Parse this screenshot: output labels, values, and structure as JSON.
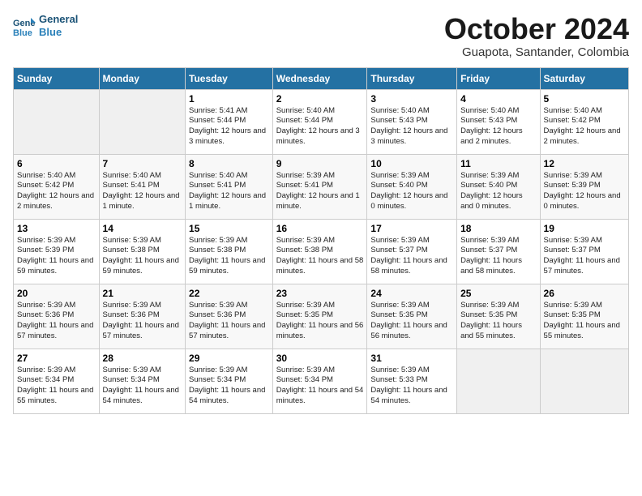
{
  "header": {
    "logo_line1": "General",
    "logo_line2": "Blue",
    "title": "October 2024",
    "subtitle": "Guapota, Santander, Colombia"
  },
  "weekdays": [
    "Sunday",
    "Monday",
    "Tuesday",
    "Wednesday",
    "Thursday",
    "Friday",
    "Saturday"
  ],
  "weeks": [
    [
      {
        "day": "",
        "info": ""
      },
      {
        "day": "",
        "info": ""
      },
      {
        "day": "1",
        "info": "Sunrise: 5:41 AM\nSunset: 5:44 PM\nDaylight: 12 hours and 3 minutes."
      },
      {
        "day": "2",
        "info": "Sunrise: 5:40 AM\nSunset: 5:44 PM\nDaylight: 12 hours and 3 minutes."
      },
      {
        "day": "3",
        "info": "Sunrise: 5:40 AM\nSunset: 5:43 PM\nDaylight: 12 hours and 3 minutes."
      },
      {
        "day": "4",
        "info": "Sunrise: 5:40 AM\nSunset: 5:43 PM\nDaylight: 12 hours and 2 minutes."
      },
      {
        "day": "5",
        "info": "Sunrise: 5:40 AM\nSunset: 5:42 PM\nDaylight: 12 hours and 2 minutes."
      }
    ],
    [
      {
        "day": "6",
        "info": "Sunrise: 5:40 AM\nSunset: 5:42 PM\nDaylight: 12 hours and 2 minutes."
      },
      {
        "day": "7",
        "info": "Sunrise: 5:40 AM\nSunset: 5:41 PM\nDaylight: 12 hours and 1 minute."
      },
      {
        "day": "8",
        "info": "Sunrise: 5:40 AM\nSunset: 5:41 PM\nDaylight: 12 hours and 1 minute."
      },
      {
        "day": "9",
        "info": "Sunrise: 5:39 AM\nSunset: 5:41 PM\nDaylight: 12 hours and 1 minute."
      },
      {
        "day": "10",
        "info": "Sunrise: 5:39 AM\nSunset: 5:40 PM\nDaylight: 12 hours and 0 minutes."
      },
      {
        "day": "11",
        "info": "Sunrise: 5:39 AM\nSunset: 5:40 PM\nDaylight: 12 hours and 0 minutes."
      },
      {
        "day": "12",
        "info": "Sunrise: 5:39 AM\nSunset: 5:39 PM\nDaylight: 12 hours and 0 minutes."
      }
    ],
    [
      {
        "day": "13",
        "info": "Sunrise: 5:39 AM\nSunset: 5:39 PM\nDaylight: 11 hours and 59 minutes."
      },
      {
        "day": "14",
        "info": "Sunrise: 5:39 AM\nSunset: 5:38 PM\nDaylight: 11 hours and 59 minutes."
      },
      {
        "day": "15",
        "info": "Sunrise: 5:39 AM\nSunset: 5:38 PM\nDaylight: 11 hours and 59 minutes."
      },
      {
        "day": "16",
        "info": "Sunrise: 5:39 AM\nSunset: 5:38 PM\nDaylight: 11 hours and 58 minutes."
      },
      {
        "day": "17",
        "info": "Sunrise: 5:39 AM\nSunset: 5:37 PM\nDaylight: 11 hours and 58 minutes."
      },
      {
        "day": "18",
        "info": "Sunrise: 5:39 AM\nSunset: 5:37 PM\nDaylight: 11 hours and 58 minutes."
      },
      {
        "day": "19",
        "info": "Sunrise: 5:39 AM\nSunset: 5:37 PM\nDaylight: 11 hours and 57 minutes."
      }
    ],
    [
      {
        "day": "20",
        "info": "Sunrise: 5:39 AM\nSunset: 5:36 PM\nDaylight: 11 hours and 57 minutes."
      },
      {
        "day": "21",
        "info": "Sunrise: 5:39 AM\nSunset: 5:36 PM\nDaylight: 11 hours and 57 minutes."
      },
      {
        "day": "22",
        "info": "Sunrise: 5:39 AM\nSunset: 5:36 PM\nDaylight: 11 hours and 57 minutes."
      },
      {
        "day": "23",
        "info": "Sunrise: 5:39 AM\nSunset: 5:35 PM\nDaylight: 11 hours and 56 minutes."
      },
      {
        "day": "24",
        "info": "Sunrise: 5:39 AM\nSunset: 5:35 PM\nDaylight: 11 hours and 56 minutes."
      },
      {
        "day": "25",
        "info": "Sunrise: 5:39 AM\nSunset: 5:35 PM\nDaylight: 11 hours and 55 minutes."
      },
      {
        "day": "26",
        "info": "Sunrise: 5:39 AM\nSunset: 5:35 PM\nDaylight: 11 hours and 55 minutes."
      }
    ],
    [
      {
        "day": "27",
        "info": "Sunrise: 5:39 AM\nSunset: 5:34 PM\nDaylight: 11 hours and 55 minutes."
      },
      {
        "day": "28",
        "info": "Sunrise: 5:39 AM\nSunset: 5:34 PM\nDaylight: 11 hours and 54 minutes."
      },
      {
        "day": "29",
        "info": "Sunrise: 5:39 AM\nSunset: 5:34 PM\nDaylight: 11 hours and 54 minutes."
      },
      {
        "day": "30",
        "info": "Sunrise: 5:39 AM\nSunset: 5:34 PM\nDaylight: 11 hours and 54 minutes."
      },
      {
        "day": "31",
        "info": "Sunrise: 5:39 AM\nSunset: 5:33 PM\nDaylight: 11 hours and 54 minutes."
      },
      {
        "day": "",
        "info": ""
      },
      {
        "day": "",
        "info": ""
      }
    ]
  ]
}
